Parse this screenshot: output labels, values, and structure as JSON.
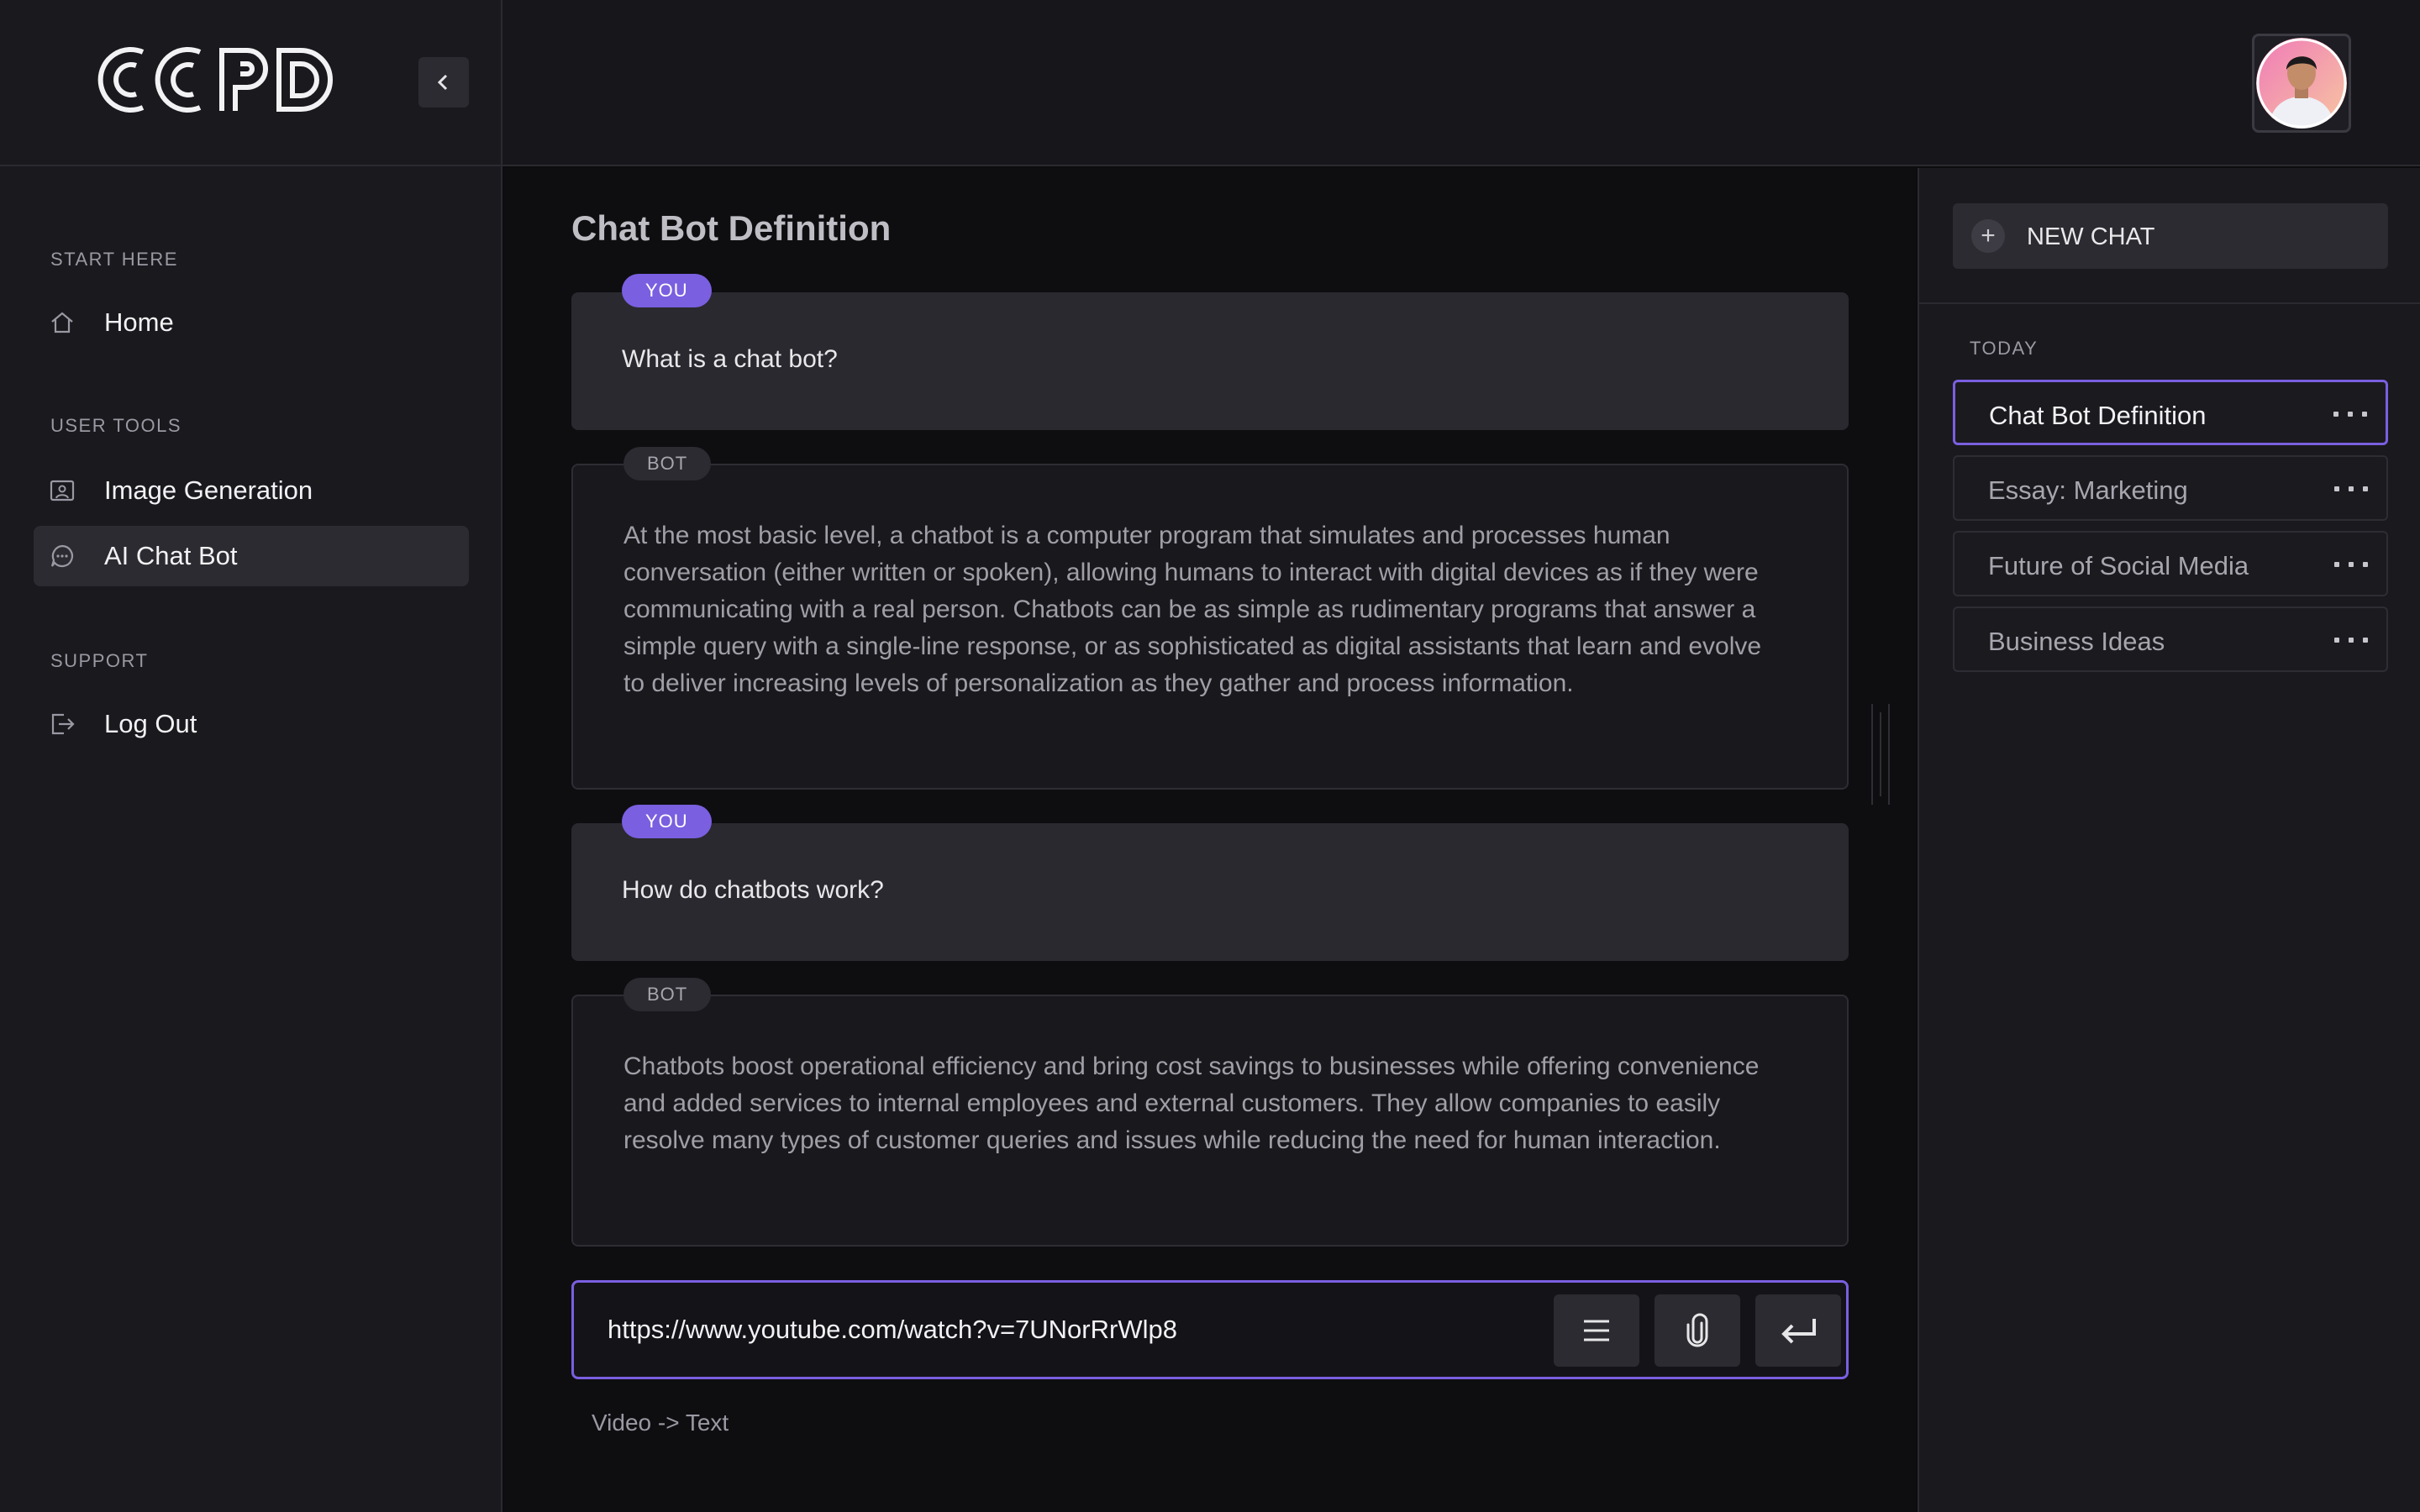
{
  "sidebar": {
    "logo_text": "CCPD",
    "sections": [
      {
        "heading": "START HERE",
        "items": [
          {
            "label": "Home",
            "icon": "home-icon"
          }
        ]
      },
      {
        "heading": "USER TOOLS",
        "items": [
          {
            "label": "Image Generation",
            "icon": "image-icon"
          },
          {
            "label": "AI Chat Bot",
            "icon": "chat-bubble-icon",
            "active": true
          }
        ]
      },
      {
        "heading": "SUPPORT",
        "items": [
          {
            "label": "Log Out",
            "icon": "logout-icon"
          }
        ]
      }
    ]
  },
  "main": {
    "title": "Chat Bot Definition",
    "messages": [
      {
        "role": "YOU",
        "text": "What is a chat bot?"
      },
      {
        "role": "BOT",
        "text": "At the most basic level, a chatbot is a computer program that simulates and processes human conversation (either written or spoken), allowing humans to interact with digital devices as if they were communicating with a real person. Chatbots can be as simple as rudimentary programs that answer a simple query with a single-line response, or as sophisticated as digital assistants that learn and evolve to deliver increasing levels of personalization as they gather and process information."
      },
      {
        "role": "YOU",
        "text": "How do chatbots work?"
      },
      {
        "role": "BOT",
        "text": "Chatbots boost operational efficiency and bring cost savings to businesses while offering convenience and added services to internal employees and external customers. They allow companies to easily resolve many types of customer queries and issues while reducing the need for human interaction."
      }
    ],
    "input": {
      "value": "https://www.youtube.com/watch?v=7UNorRrWlp8"
    },
    "input_hint": "Video -> Text"
  },
  "right_panel": {
    "new_chat_label": "NEW CHAT",
    "section_heading": "TODAY",
    "history": [
      {
        "label": "Chat Bot Definition",
        "active": true
      },
      {
        "label": "Essay: Marketing"
      },
      {
        "label": "Future of Social Media"
      },
      {
        "label": "Business Ideas"
      }
    ]
  },
  "colors": {
    "accent": "#7a5fe0",
    "background": "#0e0e11",
    "panel": "#1a191e"
  }
}
